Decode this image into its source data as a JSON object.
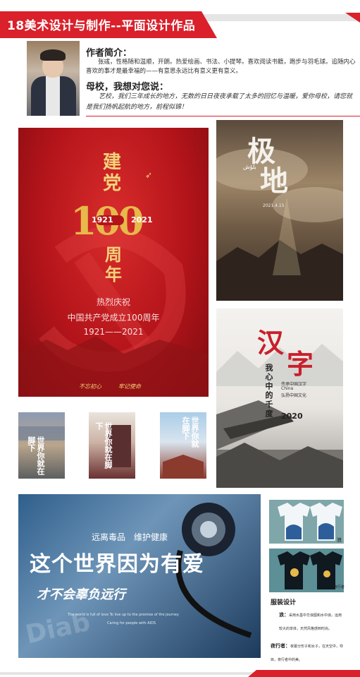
{
  "header": {
    "title": "18美术设计与制作--平面设计作品"
  },
  "author": {
    "heading": "作者简介：",
    "bio": "张彧，性格随和温顺，开朗。热爱绘画、书法、小提琴。喜欢阅读书籍，跑步与羽毛球。追随内心喜欢的事才是最幸福的——有意思永远比有意义更有意义。",
    "school_heading": "母校，我想对您说：",
    "school_message": "艺校，我们三年成长的地方，无数的日日夜夜承载了太多的回忆与温暖，爱你母校，请您就是我们扬帆起航的地方，前程似锦！"
  },
  "poster_party": {
    "big_chars": [
      "建",
      "党"
    ],
    "hundred": "100",
    "year_left": "1921",
    "year_right": "2021",
    "zhou_nian": [
      "周",
      "年"
    ],
    "line1": "热烈庆祝",
    "line2": "中国共产党成立100周年",
    "line3": "1921——2021",
    "slogan_left": "不忘初心",
    "slogan_right": "牢记使命"
  },
  "poster_polar": {
    "title_chars": [
      "极",
      "地"
    ],
    "small_label": "بلۇش",
    "date": "2021.4.15"
  },
  "poster_hanzi": {
    "title_chars": [
      "汉",
      "字"
    ],
    "vertical": "我心中的千度",
    "sub1": "传承中国汉字",
    "sub2": "China",
    "sub3": "弘扬中国文化",
    "year": "2020"
  },
  "small_posters": [
    {
      "chars": "世界你就在脚下"
    },
    {
      "chars": "世界你就在脚下"
    },
    {
      "chars": "世界你就在脚下"
    }
  ],
  "poster_drug": {
    "top_line": "远离毒品　维护健康",
    "headline": "这个世界因为有爱",
    "script_line": "才不会辜负远行",
    "en_line1": "The world is full of love To live up to the promise of the journey",
    "en_line2": "Caring for people with AIDS",
    "bg_word": "Diab"
  },
  "clothing": {
    "heading": "服装设计",
    "item1_label": "浪：",
    "item1_text": "采用水墨中华浪图和水中浪，运用较大的单体，天然风格感到时尚。",
    "item2_label": "夜行者：",
    "item2_text": "夜幕分形子和女子，在天空中，夺目，夜行者中的美。",
    "tag1": "浪",
    "tag2": "夜行者"
  },
  "colors": {
    "accent": "#d9202b",
    "gold": "#e7b94a"
  }
}
